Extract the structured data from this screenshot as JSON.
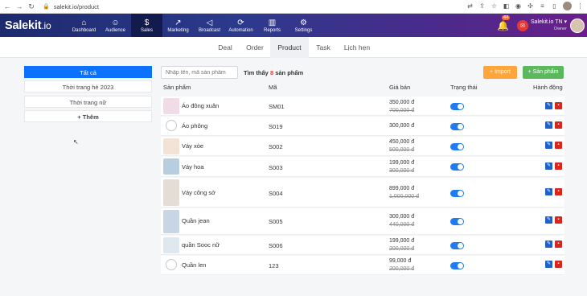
{
  "browser": {
    "url": "salekit.io/product"
  },
  "app": {
    "logo": "Salekit",
    "logo_suffix": ".io",
    "nav": [
      {
        "label": "Dashboard",
        "icon": "home-icon"
      },
      {
        "label": "Audience",
        "icon": "users-icon"
      },
      {
        "label": "Sales",
        "icon": "dollar-icon"
      },
      {
        "label": "Marketing",
        "icon": "chart-line-icon"
      },
      {
        "label": "Broadcast",
        "icon": "megaphone-icon"
      },
      {
        "label": "Automation",
        "icon": "sync-icon"
      },
      {
        "label": "Reports",
        "icon": "bar-chart-icon"
      },
      {
        "label": "Settings",
        "icon": "gear-icon"
      }
    ],
    "notification_count": "44",
    "account_name": "Salekit.io TN",
    "account_role": "Owner"
  },
  "subtabs": [
    "Deal",
    "Order",
    "Product",
    "Task",
    "Lịch hẹn"
  ],
  "categories": {
    "items": [
      "Tất cả",
      "Thời trang hè 2023",
      "Thời trang nữ"
    ],
    "add_label": "Thêm",
    "add_icon": "plus-icon"
  },
  "toolbar": {
    "search_placeholder": "Nhập tên, mã sản phẩm",
    "found_prefix": "Tìm thấy",
    "found_count": "8",
    "found_suffix": "sản phẩm",
    "import_label": "Import",
    "add_label": "Sản phẩm"
  },
  "table": {
    "headers": [
      "Sản phẩm",
      "Mã",
      "Giá bán",
      "Trạng thái",
      "Hành động"
    ],
    "rows": [
      {
        "name": "Áo đông xuân",
        "code": "SM01",
        "price": "350,000 đ",
        "old_price": "700,000 đ",
        "active": true
      },
      {
        "name": "Áo phông",
        "code": "S019",
        "price": "300,000 đ",
        "old_price": "",
        "active": true
      },
      {
        "name": "Váy xòe",
        "code": "S002",
        "price": "450,000 đ",
        "old_price": "500,000 đ",
        "active": true
      },
      {
        "name": "Váy hoa",
        "code": "S003",
        "price": "199,000 đ",
        "old_price": "300,000 đ",
        "active": true
      },
      {
        "name": "Váy công sở",
        "code": "S004",
        "price": "899,000 đ",
        "old_price": "1,000,000 đ",
        "active": true
      },
      {
        "name": "Quần jean",
        "code": "S005",
        "price": "300,000 đ",
        "old_price": "440,000 đ",
        "active": true
      },
      {
        "name": "quần Sooc nữ",
        "code": "S006",
        "price": "199,000 đ",
        "old_price": "200,000 đ",
        "active": true
      },
      {
        "name": "Quần len",
        "code": "123",
        "price": "99,000 đ",
        "old_price": "200,000 đ",
        "active": true
      }
    ]
  }
}
